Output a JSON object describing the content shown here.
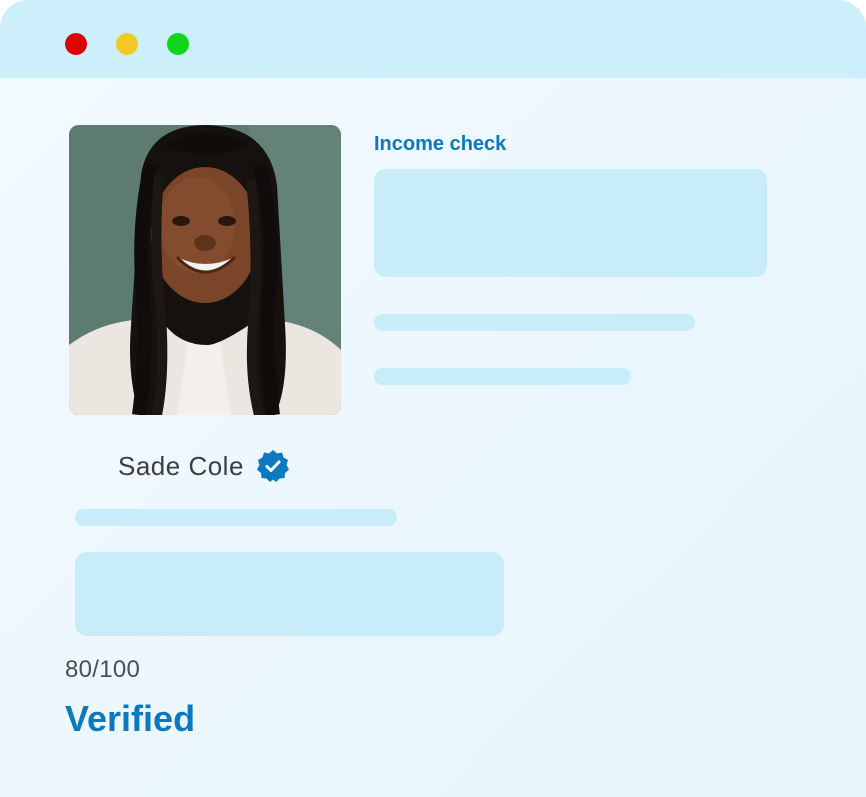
{
  "window": {
    "controls": {
      "close_color": "#e00000",
      "minimize_color": "#f5c925",
      "maximize_color": "#12d41a"
    }
  },
  "profile": {
    "name": "Sade Cole",
    "verified_icon": "verified-badge-icon",
    "accent_color": "#0a79c0"
  },
  "income_check": {
    "title": "Income check"
  },
  "result": {
    "score": "80/100",
    "status": "Verified"
  }
}
